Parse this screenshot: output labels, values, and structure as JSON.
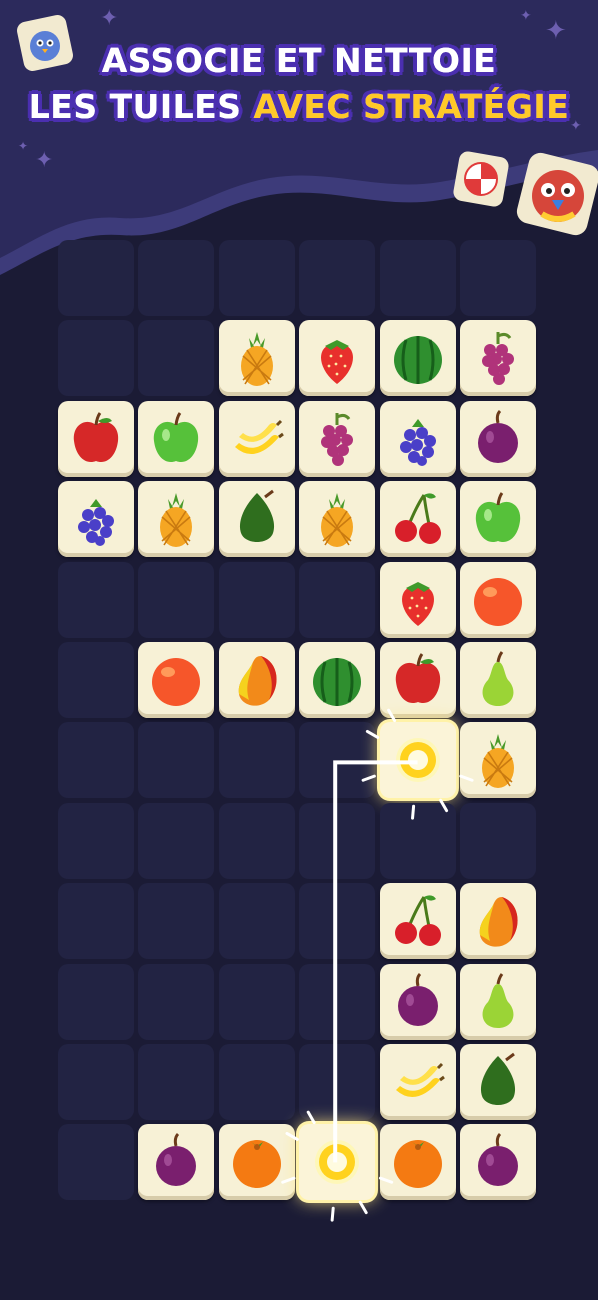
{
  "header": {
    "title_line1": "ASSOCIE ET NETTOIE",
    "title_line2_white": "LES TUILES",
    "title_line2_highlight": "AVEC STRATÉGIE"
  },
  "colors": {
    "background": "#1b1b35",
    "header_purple": "#3d3b7a",
    "tile": "#f7f1d6",
    "empty_cell": "#222343",
    "title_outline": "#4b2fb0",
    "highlight": "#ffc928"
  },
  "board": {
    "columns": 6,
    "rows": 12,
    "rows_tiles": [
      [
        "",
        "",
        "",
        "",
        "",
        ""
      ],
      [
        "",
        "",
        "pineapple",
        "strawberry",
        "watermelon",
        "grapes"
      ],
      [
        "red-apple",
        "green-apple",
        "banana",
        "grapes",
        "blackberry",
        "plum"
      ],
      [
        "blackberry",
        "pineapple",
        "avocado",
        "pineapple",
        "cherries",
        "green-apple"
      ],
      [
        "",
        "",
        "",
        "",
        "strawberry",
        "peach"
      ],
      [
        "",
        "peach",
        "mango",
        "watermelon",
        "red-apple",
        "pear"
      ],
      [
        "",
        "",
        "",
        "",
        "lemon",
        "pineapple"
      ],
      [
        "",
        "",
        "",
        "",
        "",
        ""
      ],
      [
        "",
        "",
        "",
        "",
        "cherries",
        "mango"
      ],
      [
        "",
        "",
        "",
        "",
        "plum",
        "pear"
      ],
      [
        "",
        "",
        "",
        "",
        "banana",
        "avocado"
      ],
      [
        "",
        "plum",
        "orange",
        "lemon",
        "orange",
        "plum"
      ]
    ],
    "selected": [
      [
        6,
        4
      ],
      [
        11,
        3
      ]
    ],
    "match_path": "lemon-to-lemon"
  }
}
